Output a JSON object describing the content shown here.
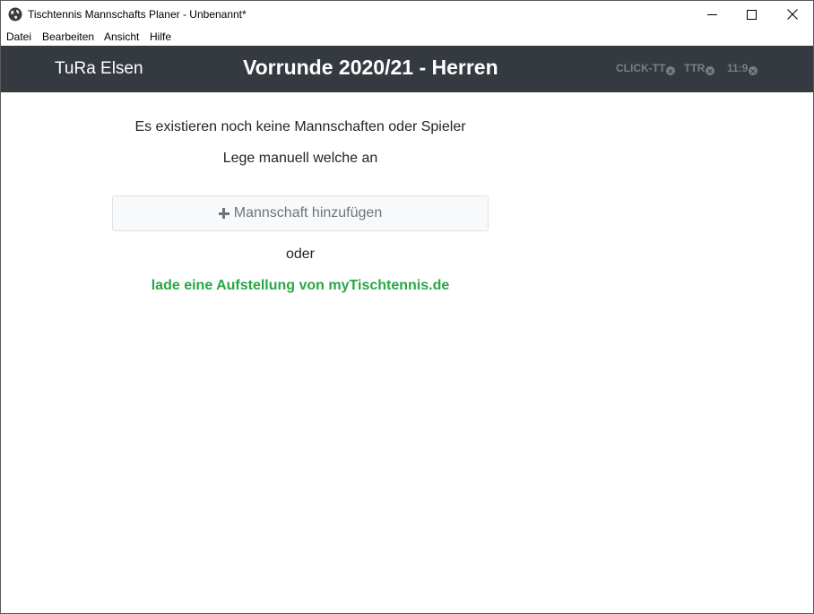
{
  "window": {
    "title": "Tischtennis Mannschafts Planer - Unbenannt*",
    "icon": "globe-app-icon"
  },
  "menu": {
    "items": [
      {
        "label": "Datei"
      },
      {
        "label": "Bearbeiten"
      },
      {
        "label": "Ansicht"
      },
      {
        "label": "Hilfe"
      }
    ]
  },
  "header": {
    "club": "TuRa Elsen",
    "title": "Vorrunde 2020/21 - Herren",
    "tags": [
      {
        "label": "CLICK-TT",
        "icon": "close-icon"
      },
      {
        "label": "TTR",
        "icon": "close-icon"
      },
      {
        "label": "11:9",
        "icon": "close-icon"
      }
    ],
    "colors": {
      "background": "#343a40",
      "tag": "#7a7f85"
    }
  },
  "main": {
    "empty_message": "Es existieren noch keine Mannschaften oder Spieler",
    "manual_hint": "Lege manuell welche an",
    "add_team_label": "Mannschaft hinzufügen",
    "add_team_icon": "plus-icon",
    "or_label": "oder",
    "import_link": "lade eine Aufstellung von myTischtennis.de",
    "colors": {
      "link": "#28a745"
    }
  }
}
